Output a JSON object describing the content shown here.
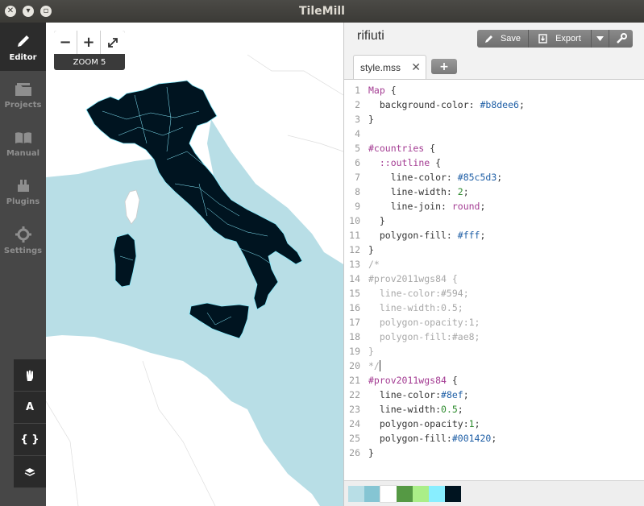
{
  "window": {
    "title": "TileMill"
  },
  "sidebar": {
    "items": [
      {
        "label": "Editor",
        "icon": "pencil-icon",
        "active": true
      },
      {
        "label": "Projects",
        "icon": "folder-icon",
        "active": false
      },
      {
        "label": "Manual",
        "icon": "book-icon",
        "active": false
      },
      {
        "label": "Plugins",
        "icon": "plugin-icon",
        "active": false
      },
      {
        "label": "Settings",
        "icon": "gear-icon",
        "active": false
      }
    ],
    "tools": [
      {
        "name": "pan-tool",
        "icon": "hand-icon"
      },
      {
        "name": "font-tool",
        "glyph": "A"
      },
      {
        "name": "carto-reference-tool",
        "glyph": "{ }"
      },
      {
        "name": "layers-tool",
        "icon": "layers-icon"
      }
    ]
  },
  "map": {
    "zoom_in": "+",
    "zoom_out": "−",
    "fullscreen_icon": "expand-icon",
    "zoom_label": "ZOOM 5",
    "colors": {
      "sea": "#b8dee6",
      "land": "#ffffff",
      "province_fill": "#001420",
      "province_line": "#88eeff"
    }
  },
  "editor": {
    "project_title": "rifiuti",
    "actions": {
      "save": "Save",
      "export": "Export"
    },
    "tabs": [
      {
        "label": "style.mss",
        "close": "✕"
      }
    ],
    "add_tab": "+",
    "code_lines": [
      [
        {
          "t": "Map",
          "c": "c-sel"
        },
        {
          "t": " {",
          "c": ""
        }
      ],
      [
        {
          "t": "  background-color: ",
          "c": ""
        },
        {
          "t": "#b8dee6",
          "c": "c-val"
        },
        {
          "t": ";",
          "c": ""
        }
      ],
      [
        {
          "t": "}",
          "c": ""
        }
      ],
      [],
      [
        {
          "t": "#countries",
          "c": "c-sel"
        },
        {
          "t": " {",
          "c": ""
        }
      ],
      [
        {
          "t": "  ::",
          "c": "c-sel"
        },
        {
          "t": "outline",
          "c": "c-kw"
        },
        {
          "t": " {",
          "c": ""
        }
      ],
      [
        {
          "t": "    line-color: ",
          "c": ""
        },
        {
          "t": "#85c5d3",
          "c": "c-val"
        },
        {
          "t": ";",
          "c": ""
        }
      ],
      [
        {
          "t": "    line-width: ",
          "c": ""
        },
        {
          "t": "2",
          "c": "c-num"
        },
        {
          "t": ";",
          "c": ""
        }
      ],
      [
        {
          "t": "    line-join: ",
          "c": ""
        },
        {
          "t": "round",
          "c": "c-kw"
        },
        {
          "t": ";",
          "c": ""
        }
      ],
      [
        {
          "t": "  }",
          "c": ""
        }
      ],
      [
        {
          "t": "  polygon-fill: ",
          "c": ""
        },
        {
          "t": "#fff",
          "c": "c-val"
        },
        {
          "t": ";",
          "c": ""
        }
      ],
      [
        {
          "t": "}",
          "c": ""
        }
      ],
      [
        {
          "t": "/*",
          "c": "c-com"
        }
      ],
      [
        {
          "t": "#prov2011wgs84 {",
          "c": "c-com"
        }
      ],
      [
        {
          "t": "  line-color:#594;",
          "c": "c-com"
        }
      ],
      [
        {
          "t": "  line-width:0.5;",
          "c": "c-com"
        }
      ],
      [
        {
          "t": "  polygon-opacity:1;",
          "c": "c-com"
        }
      ],
      [
        {
          "t": "  polygon-fill:#ae8;",
          "c": "c-com"
        }
      ],
      [
        {
          "t": "}",
          "c": "c-com"
        }
      ],
      [
        {
          "t": "*/",
          "c": "c-com"
        }
      ],
      [
        {
          "t": "#prov2011wgs84",
          "c": "c-sel"
        },
        {
          "t": " {",
          "c": ""
        }
      ],
      [
        {
          "t": "  line-color:",
          "c": ""
        },
        {
          "t": "#8ef",
          "c": "c-val"
        },
        {
          "t": ";",
          "c": ""
        }
      ],
      [
        {
          "t": "  line-width:",
          "c": ""
        },
        {
          "t": "0.5",
          "c": "c-num"
        },
        {
          "t": ";",
          "c": ""
        }
      ],
      [
        {
          "t": "  polygon-opacity:",
          "c": ""
        },
        {
          "t": "1",
          "c": "c-num"
        },
        {
          "t": ";",
          "c": ""
        }
      ],
      [
        {
          "t": "  polygon-fill:",
          "c": ""
        },
        {
          "t": "#001420",
          "c": "c-val"
        },
        {
          "t": ";",
          "c": ""
        }
      ],
      [
        {
          "t": "}",
          "c": ""
        }
      ]
    ],
    "palette": [
      "#b8dee6",
      "#85c5d3",
      "#ffffff",
      "#559944",
      "#aaee88",
      "#88eeff",
      "#001420"
    ]
  }
}
